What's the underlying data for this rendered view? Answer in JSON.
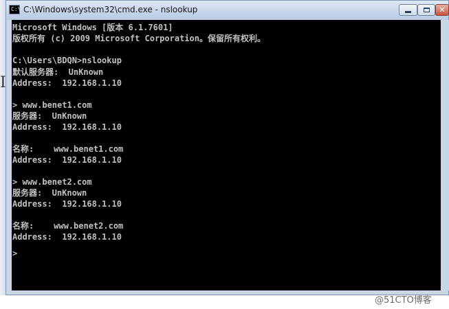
{
  "window": {
    "title": "C:\\Windows\\system32\\cmd.exe - nslookup",
    "icon": "cmd-icon",
    "controls": [
      "minimize-icon",
      "maximize-icon",
      "close-icon"
    ]
  },
  "page_fragment": "I",
  "console": {
    "background": "#000000",
    "foreground": "#c0c0c0",
    "lines": [
      "Microsoft Windows [版本 6.1.7601]",
      "版权所有 (c) 2009 Microsoft Corporation。保留所有权利。",
      "",
      "C:\\Users\\BDQN>nslookup",
      "默认服务器:  UnKnown",
      "Address:  192.168.1.10",
      "",
      "> www.benet1.com",
      "服务器:  UnKnown",
      "Address:  192.168.1.10",
      "",
      "名称:    www.benet1.com",
      "Address:  192.168.1.10",
      "",
      "> www.benet2.com",
      "服务器:  UnKnown",
      "Address:  192.168.1.10",
      "",
      "名称:    www.benet2.com",
      "Address:  192.168.1.10",
      "",
      ">"
    ]
  },
  "watermark": "@51CTO博客"
}
